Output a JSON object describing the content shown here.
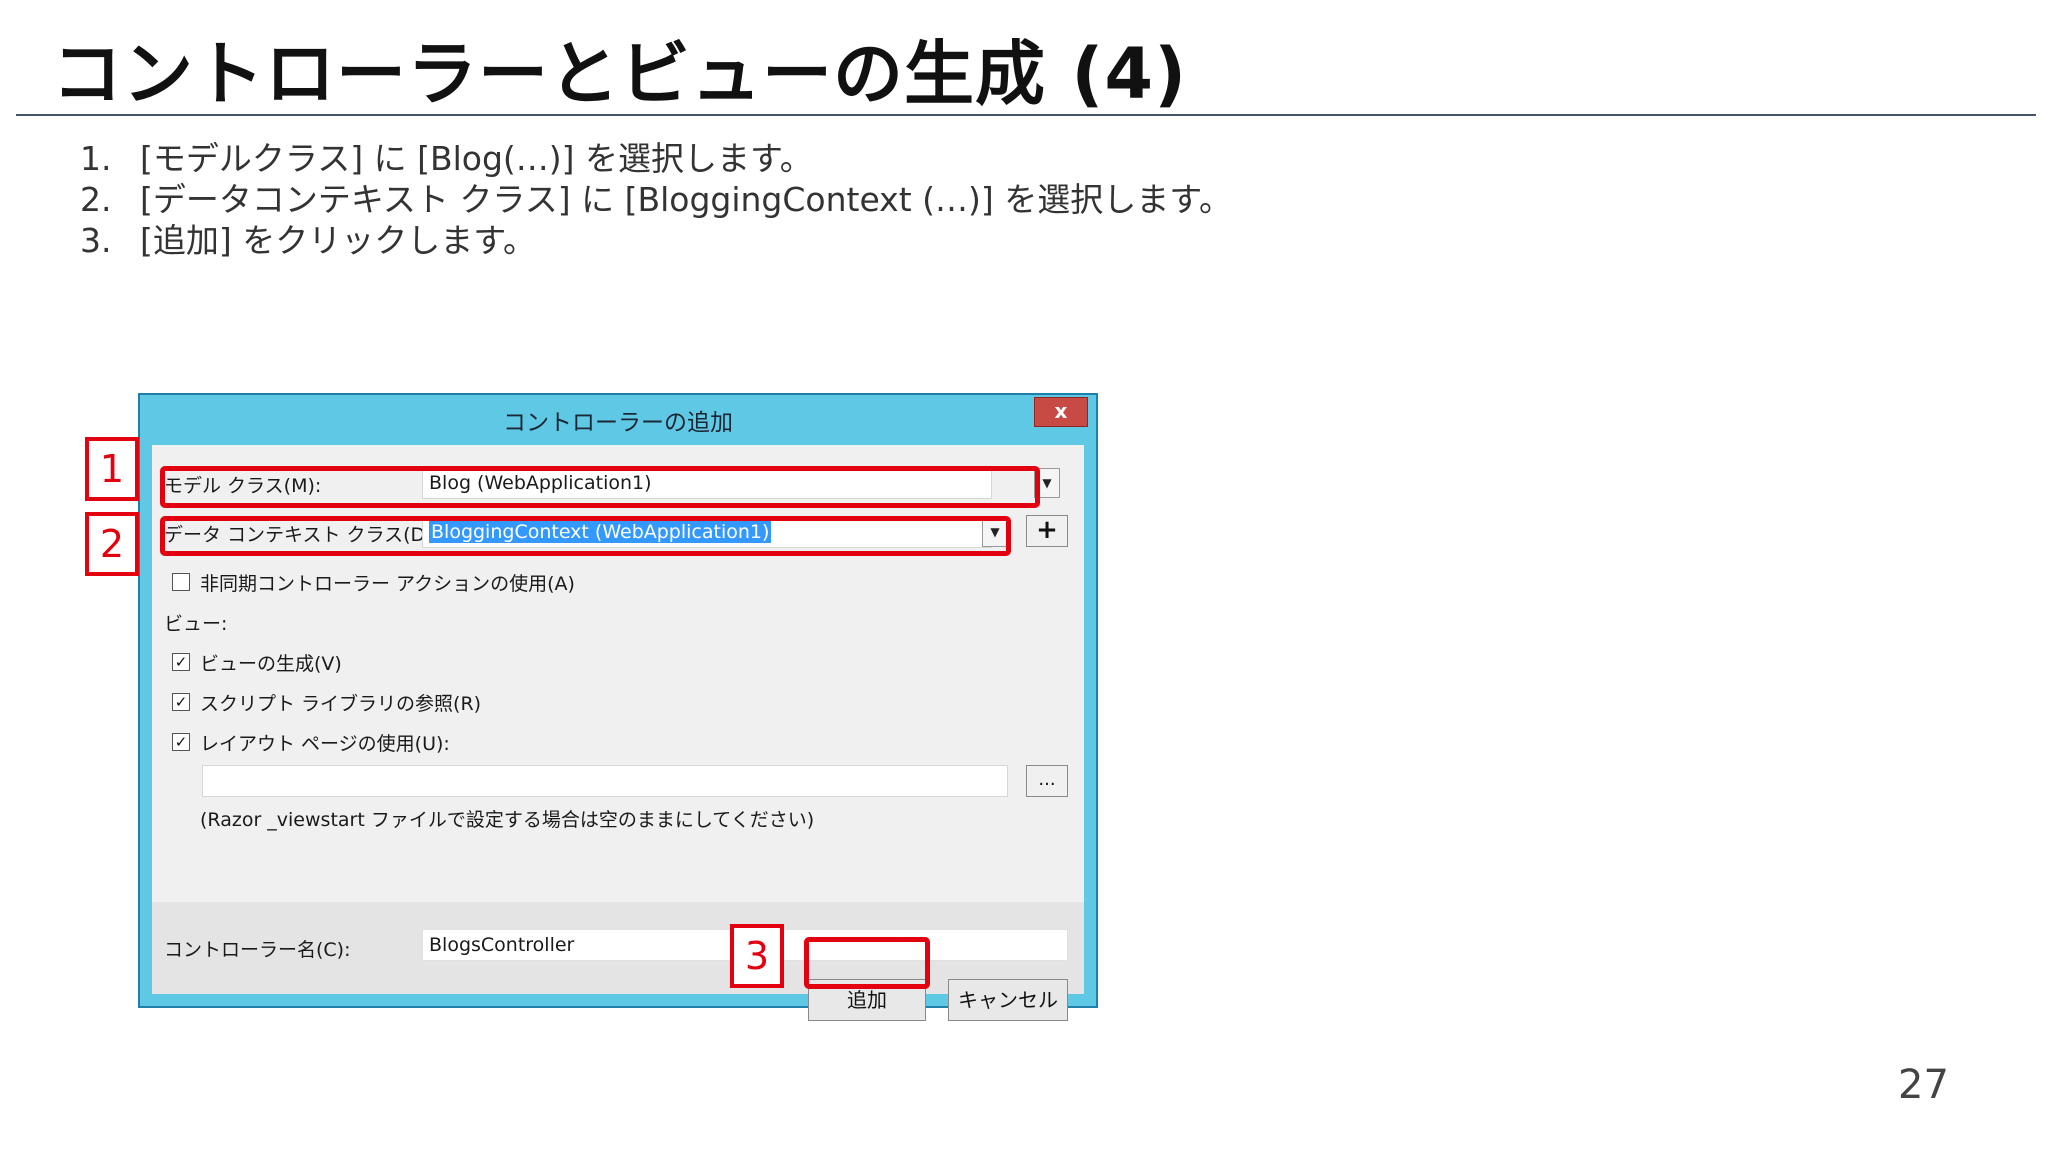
{
  "slide": {
    "title": "コントローラーとビューの生成 (4)",
    "steps": [
      {
        "num": "1.",
        "text": "[モデルクラス] に [Blog(…)] を選択します。"
      },
      {
        "num": "2.",
        "text": "[データコンテキスト クラス] に [BloggingContext (…)] を選択します。"
      },
      {
        "num": "3.",
        "text": "[追加] をクリックします。"
      }
    ],
    "page_number": "27"
  },
  "dialog": {
    "title": "コントローラーの追加",
    "close_label": "x",
    "model_class": {
      "label": "モデル クラス(M):",
      "value": "Blog (WebApplication1)"
    },
    "data_context": {
      "label": "データ コンテキスト クラス(D):",
      "value": "BloggingContext (WebApplication1)",
      "add_label": "+"
    },
    "async_actions": {
      "label": "非同期コントローラー アクションの使用(A)",
      "checked": false
    },
    "views_heading": "ビュー:",
    "generate_views": {
      "label": "ビューの生成(V)",
      "checked": true
    },
    "script_libs": {
      "label": "スクリプト ライブラリの参照(R)",
      "checked": true
    },
    "use_layout": {
      "label": "レイアウト ページの使用(U):",
      "checked": true
    },
    "layout_path": {
      "value": "",
      "browse_label": "..."
    },
    "layout_hint": "(Razor _viewstart ファイルで設定する場合は空のままにしてください)",
    "controller_name": {
      "label": "コントローラー名(C):",
      "value": "BlogsController"
    },
    "add_button": "追加",
    "cancel_button": "キャンセル",
    "check_mark": "✓",
    "dropdown_arrow": "▼"
  },
  "callouts": [
    "1",
    "2",
    "3"
  ],
  "colors": {
    "accent_red": "#e3000f",
    "titlebar": "#5fc9e5",
    "selection": "#3399ff"
  }
}
